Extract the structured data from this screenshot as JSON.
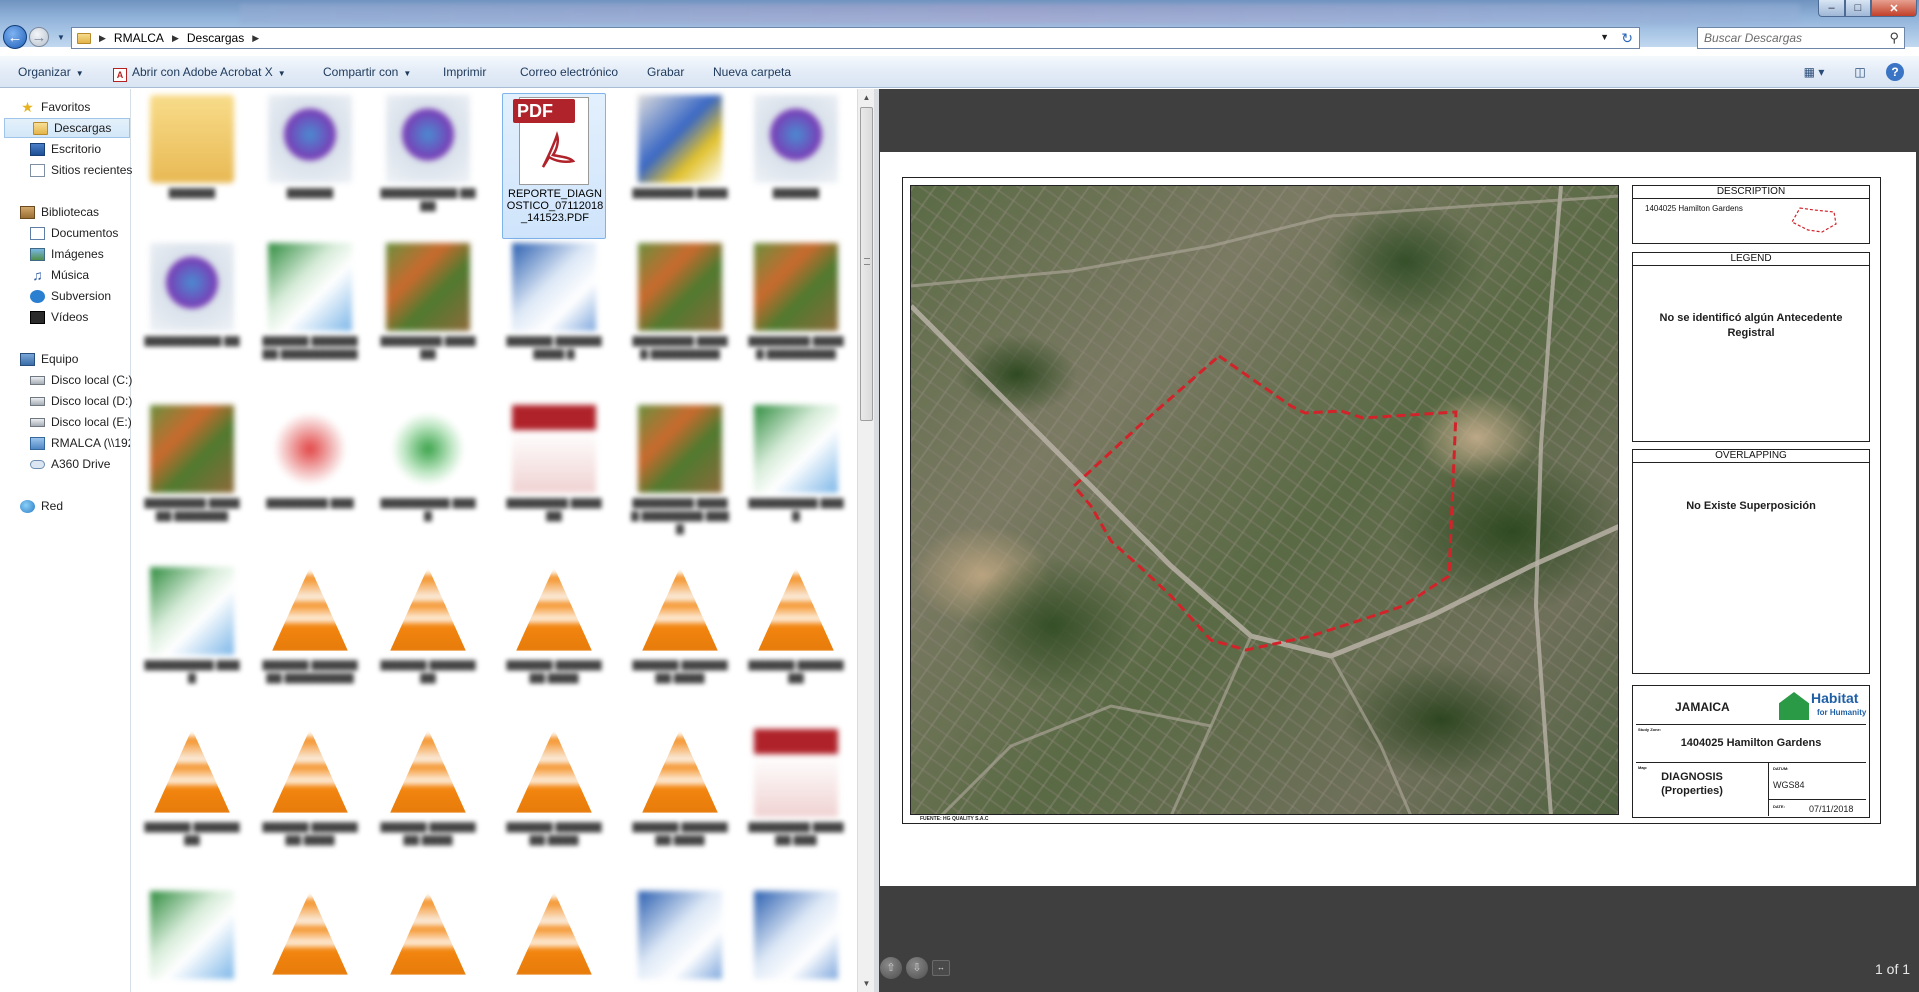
{
  "window": {
    "min_icon": "minimize-icon",
    "max_icon": "maximize-icon",
    "close_icon": "close-icon"
  },
  "address_bar": {
    "path": [
      "RMALCA",
      "Descargas"
    ],
    "search_placeholder": "Buscar Descargas"
  },
  "toolbar": {
    "organize": "Organizar",
    "open_with": "Abrir con Adobe Acrobat X",
    "share": "Compartir con",
    "print": "Imprimir",
    "email": "Correo electrónico",
    "burn": "Grabar",
    "new_folder": "Nueva carpeta"
  },
  "nav": {
    "favorites": "Favoritos",
    "fav_items": [
      "Descargas",
      "Escritorio",
      "Sitios recientes"
    ],
    "libraries": "Bibliotecas",
    "lib_items": [
      "Documentos",
      "Imágenes",
      "Música",
      "Subversion",
      "Vídeos"
    ],
    "computer": "Equipo",
    "comp_items": [
      "Disco local (C:)",
      "Disco local (D:)",
      "Disco local (E:)",
      "RMALCA (\\\\192",
      "A360 Drive"
    ],
    "network": "Red"
  },
  "files": {
    "selected_name": "REPORTE_DIAGNOSTICO_07112018_141523.PDF",
    "pdf_badge": "PDF"
  },
  "preview": {
    "description_header": "DESCRIPTION",
    "description_text": "1404025 Hamilton Gardens",
    "legend_header": "LEGEND",
    "legend_text": "No se identificó algún Antecedente Registral",
    "overlapping_header": "OVERLAPPING",
    "overlapping_text": "No Existe Superposición",
    "country": "JAMAICA",
    "logo_name": "Habitat",
    "logo_sub": "for Humanity",
    "study_zone_label": "Study Zone:",
    "study_zone": "1404025 Hamilton Gardens",
    "map_label": "Map:",
    "map_value": "DIAGNOSIS (Properties)",
    "datum_label": "DATUM:",
    "datum": "WGS84",
    "date_label": "DATE:",
    "date": "07/11/2018",
    "source": "FUENTE: HG QUALITY S.A.C",
    "page_count": "1 of 1"
  },
  "colors": {
    "boundary": "#d2232a",
    "selection": "#cfe4fb",
    "preview_bg": "#3f3f3f"
  }
}
